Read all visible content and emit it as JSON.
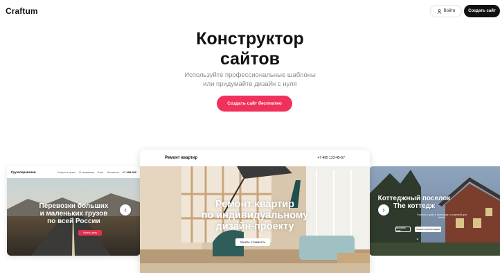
{
  "header": {
    "logo": "Craftum",
    "login_label": "Войти",
    "create_label": "Создать сайт"
  },
  "hero": {
    "title_line1": "Конструктор",
    "title_line2": "сайтов",
    "subtitle_line1": "Используйте профессиональные шаблоны",
    "subtitle_line2": "или придумайте дизайн с нуля",
    "cta_label": "Создать сайт бесплатно"
  },
  "templates": {
    "left": {
      "brand": "Грузоперевозки",
      "links": [
        "Услуги и цены",
        "О компании",
        "Блог",
        "Контакты"
      ],
      "phone": "+7 495 000",
      "title_line1": "Перевозки больших",
      "title_line2": "и маленьких грузов",
      "title_line3": "по всей России",
      "button": "Узнать цены"
    },
    "center": {
      "brand": "Ремонт квартир",
      "phone": "+7 495 123-45-67",
      "title_line1": "Ремонт квартир",
      "title_line2": "по индивидуальному",
      "title_line3": "дизайн-проекту",
      "button": "Узнать стоимость"
    },
    "right": {
      "title_line1": "Коттеджный поселок",
      "title_line2": "The коттедж",
      "desc": "Участки и дома в пригороде, с отделкой для жизни",
      "btn1": "Выбрать дом",
      "btn2": "Скачать презентацию"
    }
  },
  "arrows": {
    "prev": "‹",
    "next": "›"
  }
}
